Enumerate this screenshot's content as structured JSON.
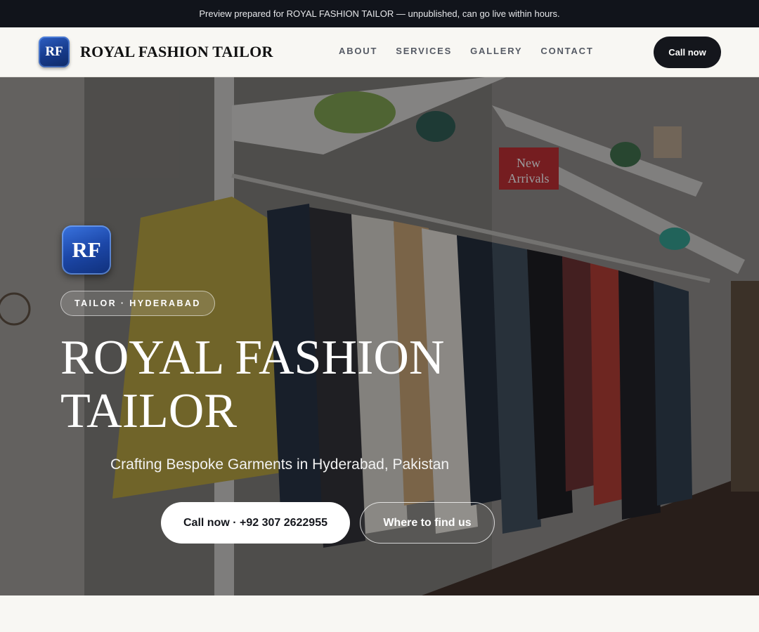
{
  "banner": {
    "text": "Preview prepared for ROYAL FASHION TAILOR — unpublished, can go live within hours."
  },
  "nav": {
    "logo_initials": "RF",
    "brand": "ROYAL FASHION TAILOR",
    "links": [
      "ABOUT",
      "SERVICES",
      "GALLERY",
      "CONTACT"
    ],
    "cta_label": "Call now"
  },
  "hero": {
    "badge_initials": "RF",
    "tag": "TAILOR · HYDERABAD",
    "title": "ROYAL FASHION TAILOR",
    "subtitle": "Crafting Bespoke Garments in Hyderabad, Pakistan",
    "primary_button": "Call now · +92 307 2622955",
    "secondary_button": "Where to find us",
    "sign_text": "New Arrivals",
    "image_description_icon": "clothing-store-photo"
  },
  "colors": {
    "banner_bg": "#11141b",
    "page_bg": "#f8f7f3",
    "accent_dark": "#14161c",
    "badge_blue": "#1c47a8"
  }
}
